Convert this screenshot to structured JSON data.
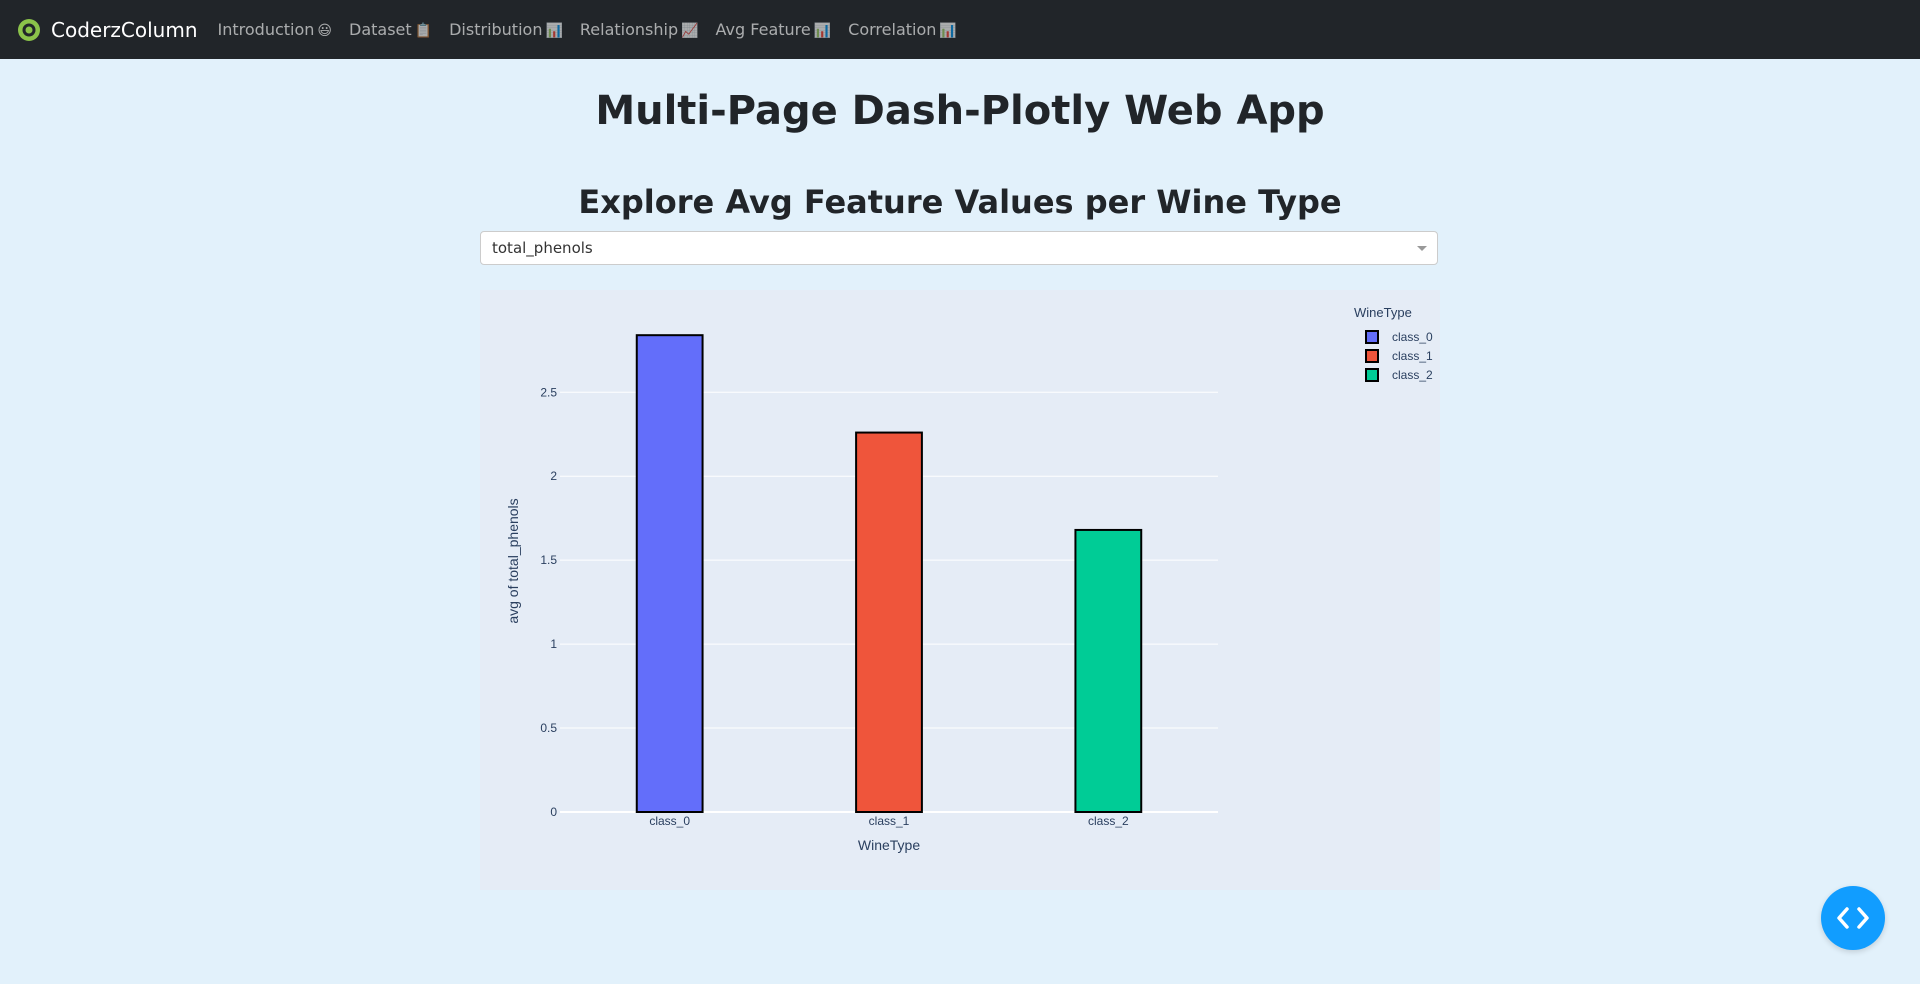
{
  "nav": {
    "brand": "CoderzColumn",
    "items": [
      {
        "label": "Introduction",
        "emoji": "😃"
      },
      {
        "label": "Dataset",
        "emoji": "📋"
      },
      {
        "label": "Distribution",
        "emoji": "📊"
      },
      {
        "label": "Relationship",
        "emoji": "📈"
      },
      {
        "label": "Avg Feature",
        "emoji": "📊"
      },
      {
        "label": "Correlation",
        "emoji": "📊"
      }
    ]
  },
  "page": {
    "title": "Multi-Page Dash-Plotly Web App",
    "section_title": "Explore Avg Feature Values per Wine Type"
  },
  "feature_dropdown": {
    "selected": "total_phenols"
  },
  "colors": {
    "navbar": "#212529",
    "page_bg": "#e2f1fb",
    "plot_bg": "#e5ecf6",
    "fab": "#119dff",
    "brand_logo": "#8bc34a"
  },
  "chart_data": {
    "type": "bar",
    "categories": [
      "class_0",
      "class_1",
      "class_2"
    ],
    "values": [
      2.84,
      2.26,
      1.68
    ],
    "colors": [
      "#636efa",
      "#ef553b",
      "#00cc96"
    ],
    "xlabel": "WineType",
    "ylabel": "avg of total_phenols",
    "ylim": [
      0,
      2.99
    ],
    "yticks": [
      0,
      0.5,
      1,
      1.5,
      2,
      2.5
    ],
    "ytick_labels": [
      "0",
      "0.5",
      "1",
      "1.5",
      "2",
      "2.5"
    ],
    "legend": {
      "title": "WineType",
      "placement": "top-right",
      "entries": [
        "class_0",
        "class_1",
        "class_2"
      ]
    },
    "grid": true
  },
  "fab": {
    "icon": "code-icon"
  }
}
